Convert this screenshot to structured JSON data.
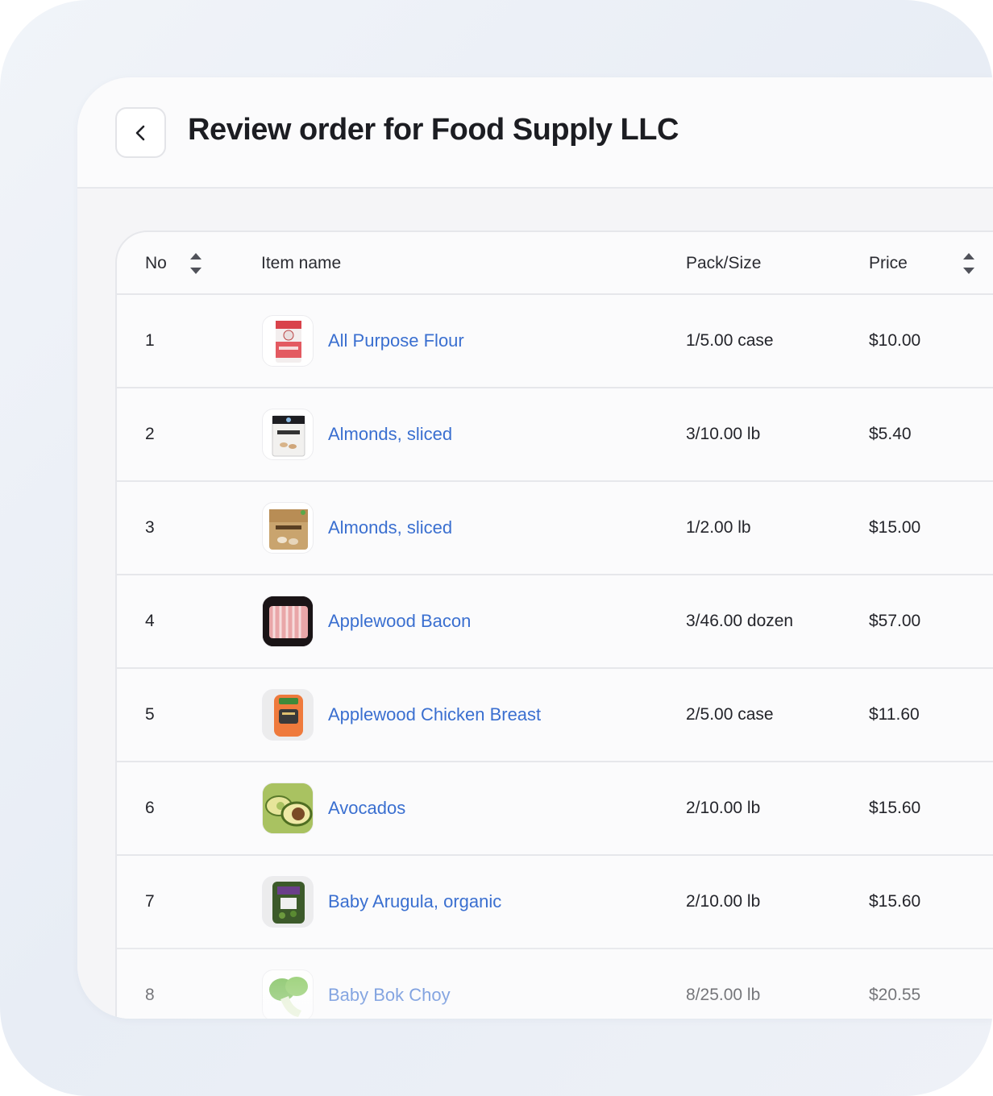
{
  "header": {
    "title": "Review order for Food Supply LLC"
  },
  "table": {
    "columns": {
      "no": "No",
      "item_name": "Item name",
      "pack_size": "Pack/Size",
      "price": "Price"
    },
    "rows": [
      {
        "no": "1",
        "name": "All Purpose Flour",
        "pack": "1/5.00 case",
        "price": "$10.00"
      },
      {
        "no": "2",
        "name": "Almonds, sliced",
        "pack": "3/10.00 lb",
        "price": "$5.40"
      },
      {
        "no": "3",
        "name": "Almonds, sliced",
        "pack": "1/2.00 lb",
        "price": "$15.00"
      },
      {
        "no": "4",
        "name": "Applewood Bacon",
        "pack": "3/46.00 dozen",
        "price": "$57.00"
      },
      {
        "no": "5",
        "name": "Applewood Chicken Breast",
        "pack": "2/5.00 case",
        "price": "$11.60"
      },
      {
        "no": "6",
        "name": "Avocados",
        "pack": "2/10.00 lb",
        "price": "$15.60"
      },
      {
        "no": "7",
        "name": "Baby Arugula, organic",
        "pack": "2/10.00 lb",
        "price": "$15.60"
      },
      {
        "no": "8",
        "name": "Baby Bok Choy",
        "pack": "8/25.00 lb",
        "price": "$20.55"
      }
    ]
  },
  "colors": {
    "link": "#3a6fd0",
    "text": "#24252b",
    "border": "#e6e7eb"
  }
}
